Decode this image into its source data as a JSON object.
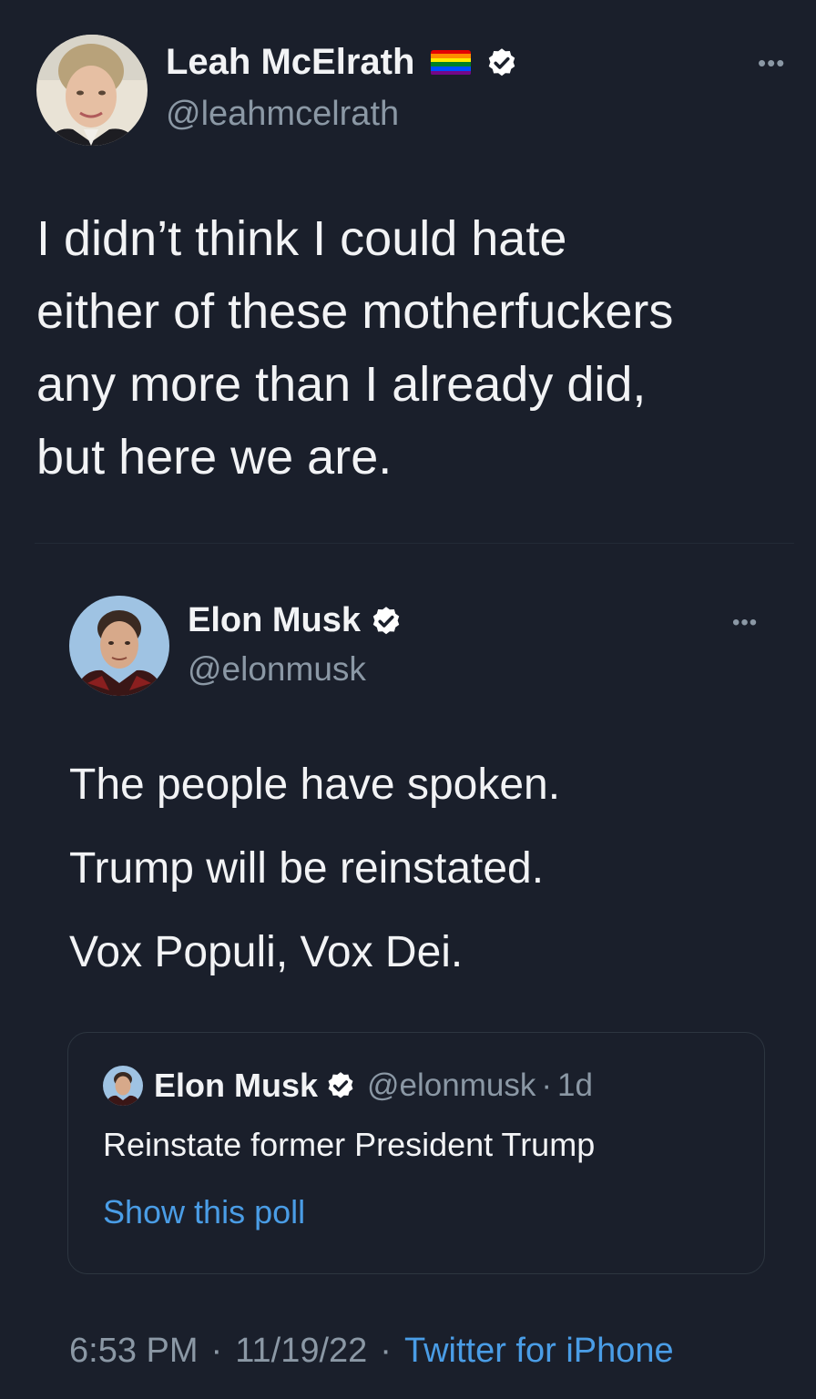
{
  "main_tweet": {
    "author_name": "Leah McElrath",
    "author_handle": "@leahmcelrath",
    "text": "I didn’t think I could hate\neither of these motherfuckers\nany more than I already did,\nbut here we are.",
    "more_icon": "more-horizontal-icon",
    "flag_colors": [
      "#e40303",
      "#ff8c00",
      "#ffed00",
      "#008026",
      "#004dff",
      "#750787"
    ]
  },
  "quoted_tweet": {
    "author_name": "Elon Musk",
    "author_handle": "@elonmusk",
    "lines": [
      "The people have spoken.",
      "Trump will be reinstated.",
      "Vox Populi, Vox Dei."
    ],
    "nested": {
      "author_name": "Elon Musk",
      "author_handle": "@elonmusk",
      "separator": "·",
      "time": "1d",
      "text": "Reinstate former President Trump",
      "link": "Show this poll"
    }
  },
  "footer": {
    "time": "6:53 PM",
    "date": "11/19/22",
    "separator": "·",
    "source": "Twitter for iPhone"
  },
  "colors": {
    "background": "#1a1f2b",
    "text": "#f2f3f5",
    "secondary": "#8b98a5",
    "link": "#4a9de6"
  }
}
